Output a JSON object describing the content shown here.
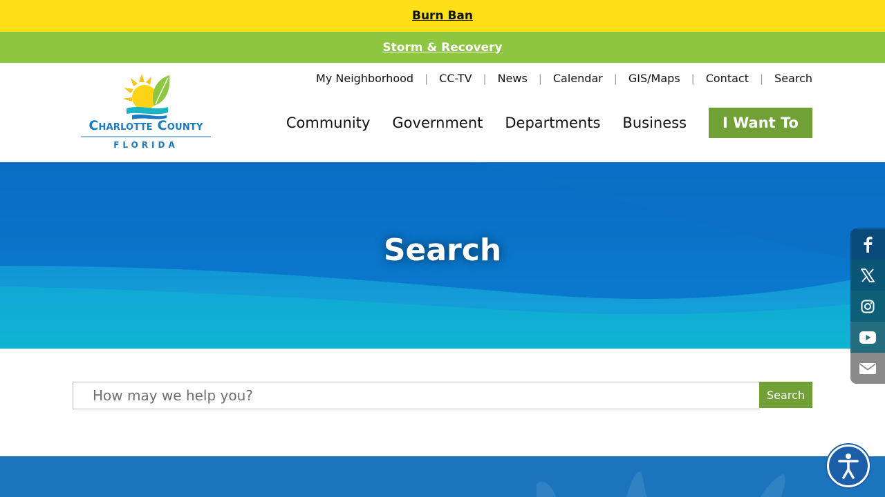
{
  "alerts": {
    "burn_ban": "Burn Ban",
    "storm": "Storm & Recovery"
  },
  "logo": {
    "name": "Charlotte County",
    "state": "FLORIDA"
  },
  "utility_nav": [
    "My Neighborhood",
    "CC-TV",
    "News",
    "Calendar",
    "GIS/Maps",
    "Contact",
    "Search"
  ],
  "main_nav": {
    "items": [
      "Community",
      "Government",
      "Departments",
      "Business"
    ],
    "cta": "I Want To"
  },
  "hero": {
    "title": "Search"
  },
  "search": {
    "placeholder": "How may we help you?",
    "button": "Search"
  },
  "social": {
    "icons": [
      "facebook-icon",
      "x-icon",
      "instagram-icon",
      "youtube-icon",
      "email-icon"
    ],
    "colors": [
      "#0a4a7a",
      "#0b5577",
      "#0d5f78",
      "#256d7e",
      "#8a8a8a"
    ]
  },
  "colors": {
    "alert_yellow": "#ffdf17",
    "alert_green": "#8dc63f",
    "brand_green": "#71a136",
    "brand_blue": "#1a7abf"
  }
}
